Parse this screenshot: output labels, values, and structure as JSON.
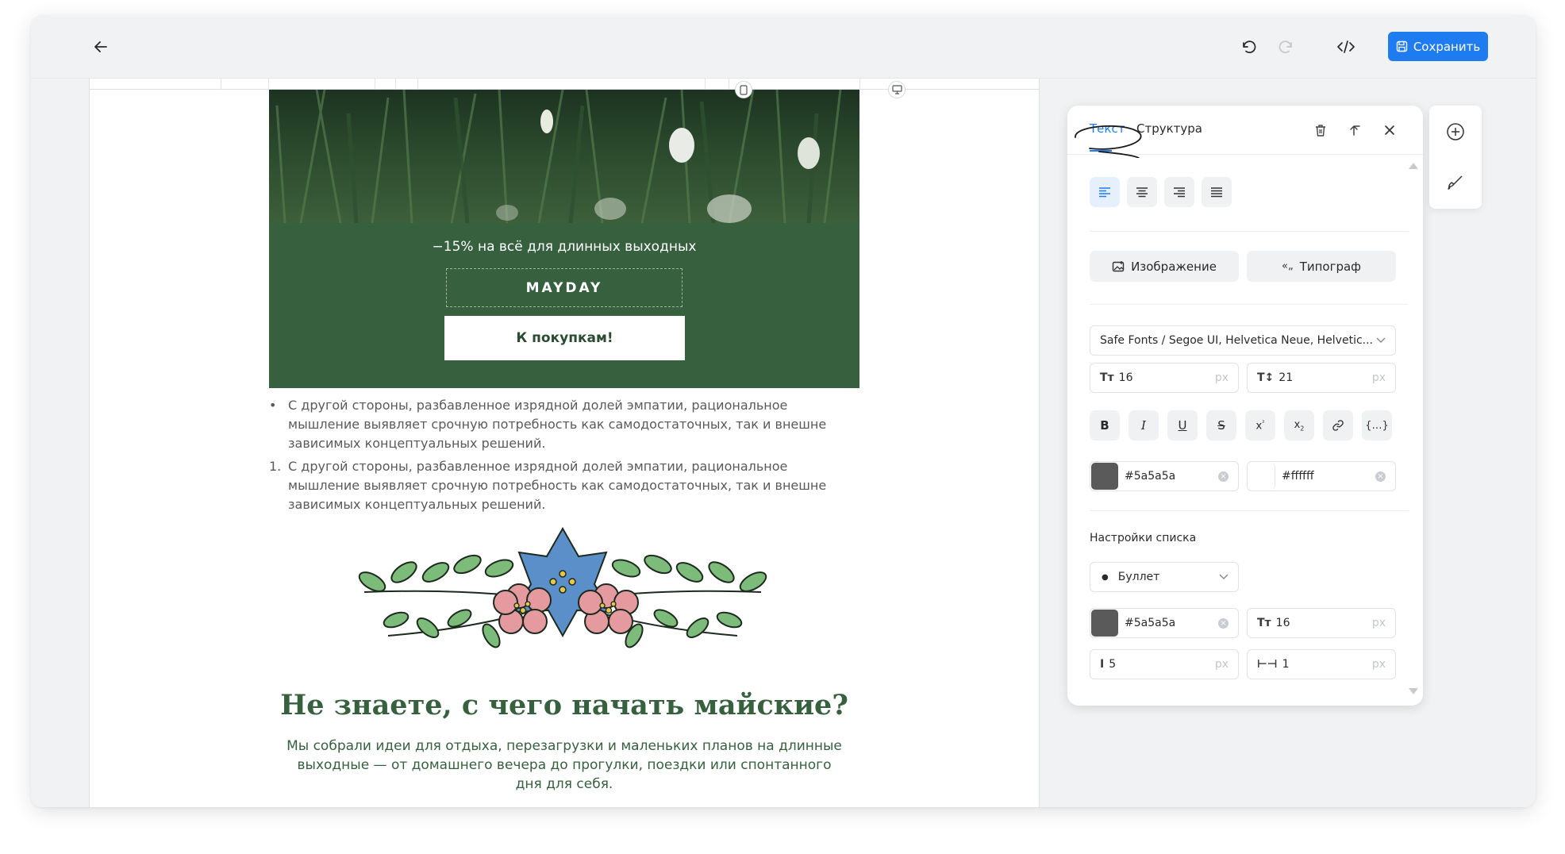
{
  "toolbar": {
    "back_icon": "arrow-left-icon",
    "undo_icon": "undo-icon",
    "redo_icon": "redo-icon",
    "code_icon": "code-icon",
    "save_label": "Сохранить",
    "save_icon": "floppy-disk-icon",
    "accent": "#1f7bf0"
  },
  "email": {
    "promo_title": "−15% на всё для длинных выходных",
    "promo_code": "MAYDAY",
    "promo_button": "К покупкам!",
    "promo_bg": "#37603f",
    "bullet_marker": "•",
    "bullet_text": "С другой стороны, разбавленное изрядной долей эмпатии, рациональное мышление выявляет срочную потребность как самодостаточных, так и внешне зависимых концептуальных решений.",
    "numbered_marker": "1.",
    "numbered_text": "С другой стороны, разбавленное изрядной долей эмпатии, рациональное мышление выявляет срочную потребность как самодостаточных, так и внешне зависимых концептуальных решений.",
    "heading": "Не знаете, с чего начать майские?",
    "subtext": "Мы собрали идеи для отдыха, перезагрузки и маленьких планов на длинные выходные — от домашнего вечера до прогулки, поездки или спонтанного дня для себя."
  },
  "panel": {
    "tab_text": "Текст",
    "tab_structure": "Структура",
    "image_button": "Изображение",
    "typograph_button": "Типограф",
    "font_select": "Safe Fonts / Segoe UI, Helvetica Neue, Helvetic...",
    "font_size": "16",
    "line_height": "21",
    "unit": "px",
    "text_color": "#5a5a5a",
    "bg_color": "#ffffff",
    "list_settings_label": "Настройки списка",
    "list_type": "Буллет",
    "list_marker_color": "#5a5a5a",
    "list_marker_size": "16",
    "list_spacing": "5",
    "list_indent": "1"
  }
}
